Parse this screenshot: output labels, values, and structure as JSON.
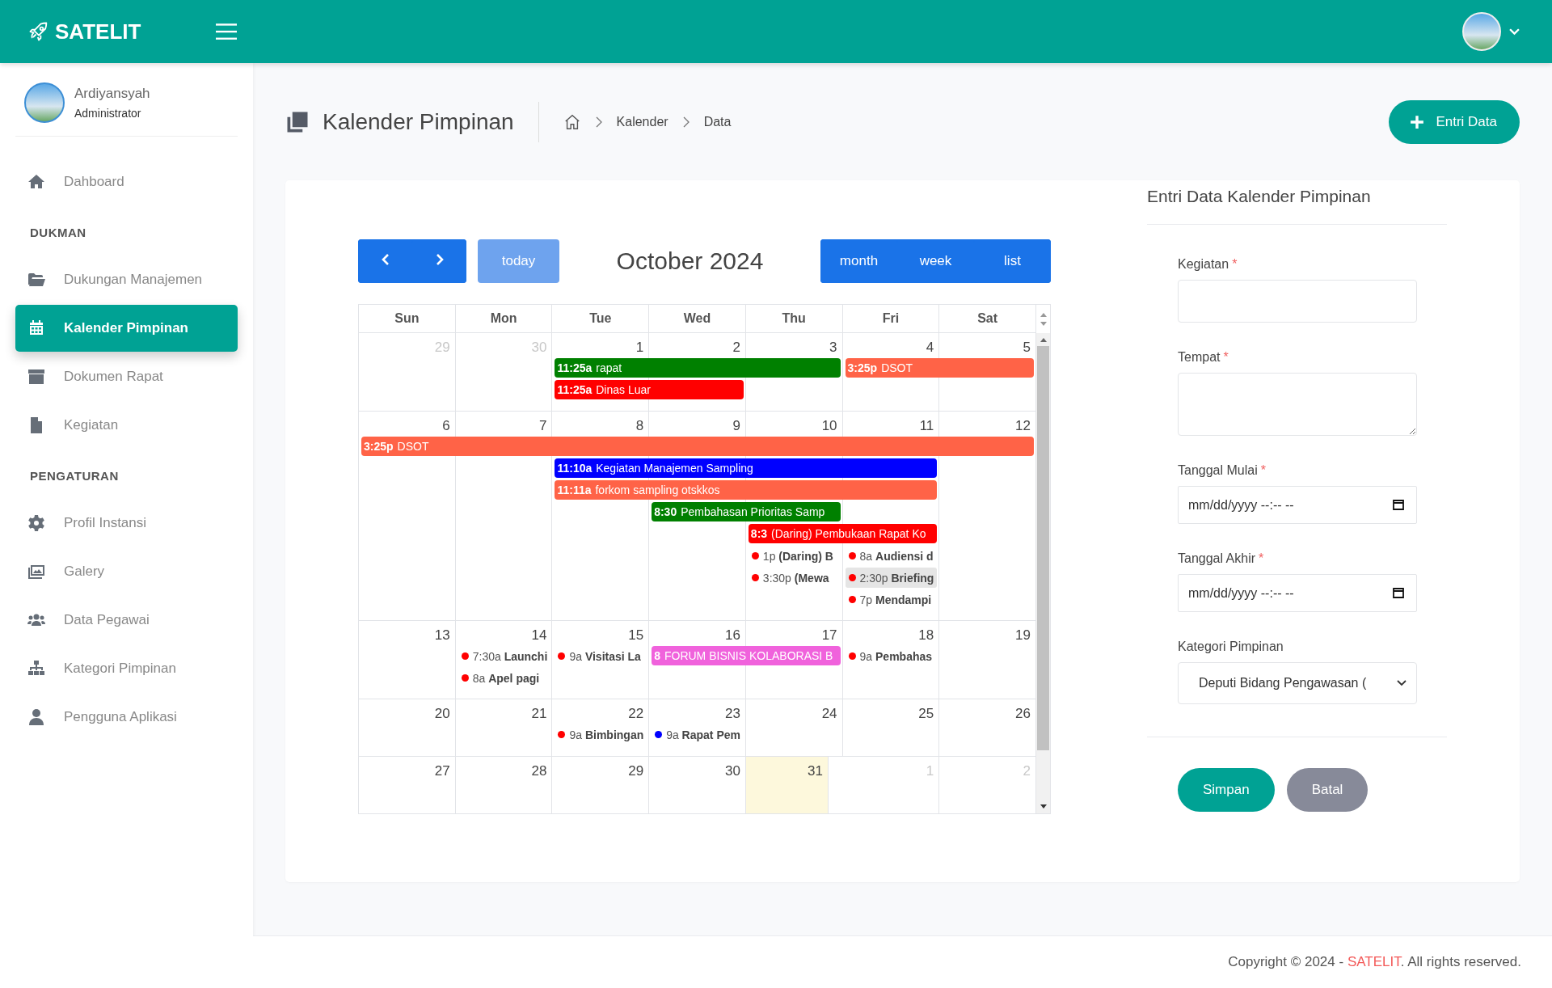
{
  "topbar": {
    "brand": "SATELIT"
  },
  "user": {
    "name": "Ardiyansyah",
    "role": "Administrator"
  },
  "sidebar": {
    "sections": [
      {
        "items": [
          {
            "label": "Dahboard",
            "selected": false
          }
        ]
      },
      {
        "heading": "DUKMAN",
        "items": [
          {
            "label": "Dukungan Manajemen",
            "selected": false
          },
          {
            "label": "Kalender Pimpinan",
            "selected": true
          },
          {
            "label": "Dokumen Rapat",
            "selected": false
          },
          {
            "label": "Kegiatan",
            "selected": false
          }
        ]
      },
      {
        "heading": "PENGATURAN",
        "items": [
          {
            "label": "Profil Instansi",
            "selected": false
          },
          {
            "label": "Galery",
            "selected": false
          },
          {
            "label": "Data Pegawai",
            "selected": false
          },
          {
            "label": "Kategori Pimpinan",
            "selected": false
          },
          {
            "label": "Pengguna Aplikasi",
            "selected": false
          }
        ]
      }
    ]
  },
  "page": {
    "title": "Kalender Pimpinan",
    "breadcrumb": [
      "Kalender",
      "Data"
    ],
    "add_button": "Entri Data"
  },
  "calendar": {
    "today_button": {
      "label": "today",
      "disabled": true
    },
    "title": "October 2024",
    "views": [
      "month",
      "week",
      "list"
    ],
    "weekdays": [
      "Sun",
      "Mon",
      "Tue",
      "Wed",
      "Thu",
      "Fri",
      "Sat"
    ],
    "weeks": [
      {
        "days": [
          {
            "label": "29",
            "other_month": true,
            "today": false
          },
          {
            "label": "30",
            "other_month": true,
            "today": false
          },
          {
            "label": "1",
            "other_month": false,
            "today": false
          },
          {
            "label": "2",
            "other_month": false,
            "today": false
          },
          {
            "label": "3",
            "other_month": false,
            "today": false
          },
          {
            "label": "4",
            "other_month": false,
            "today": false
          },
          {
            "label": "5",
            "other_month": false,
            "today": false
          }
        ],
        "lanes": [
          [
            {
              "kind": "empty"
            },
            {
              "kind": "empty"
            },
            {
              "kind": "bar",
              "time": "11:25a",
              "title": "rapat",
              "color": "#008000"
            },
            {
              "kind": "continued"
            },
            {
              "kind": "continued"
            },
            {
              "kind": "bar",
              "time": "3:25p",
              "title": "DSOT",
              "color": "#ff6347"
            },
            {
              "kind": "continued"
            }
          ],
          [
            {
              "kind": "empty"
            },
            {
              "kind": "empty"
            },
            {
              "kind": "bar",
              "time": "11:25a",
              "title": "Dinas Luar",
              "color": "#ff0000"
            },
            {
              "kind": "continued"
            },
            {
              "kind": "empty"
            },
            {
              "kind": "empty"
            },
            {
              "kind": "empty"
            }
          ]
        ]
      },
      {
        "days": [
          {
            "label": "6",
            "other_month": false,
            "today": false
          },
          {
            "label": "7",
            "other_month": false,
            "today": false
          },
          {
            "label": "8",
            "other_month": false,
            "today": false
          },
          {
            "label": "9",
            "other_month": false,
            "today": false
          },
          {
            "label": "10",
            "other_month": false,
            "today": false
          },
          {
            "label": "11",
            "other_month": false,
            "today": false
          },
          {
            "label": "12",
            "other_month": false,
            "today": false
          }
        ],
        "lanes": [
          [
            {
              "kind": "bar",
              "time": "3:25p",
              "title": "DSOT",
              "color": "#ff6347"
            },
            {
              "kind": "continued"
            },
            {
              "kind": "continued"
            },
            {
              "kind": "continued"
            },
            {
              "kind": "continued"
            },
            {
              "kind": "continued"
            },
            {
              "kind": "continued"
            }
          ],
          [
            {
              "kind": "empty"
            },
            {
              "kind": "empty"
            },
            {
              "kind": "bar",
              "time": "11:10a",
              "title": "Kegiatan Manajemen Sampling",
              "color": "#0000ff"
            },
            {
              "kind": "continued"
            },
            {
              "kind": "continued"
            },
            {
              "kind": "continued"
            },
            {
              "kind": "empty"
            }
          ],
          [
            {
              "kind": "empty"
            },
            {
              "kind": "empty"
            },
            {
              "kind": "bar",
              "time": "11:11a",
              "title": "forkom sampling otskkos",
              "color": "#ff6347"
            },
            {
              "kind": "continued"
            },
            {
              "kind": "continued"
            },
            {
              "kind": "continued"
            },
            {
              "kind": "empty"
            }
          ],
          [
            {
              "kind": "empty"
            },
            {
              "kind": "empty"
            },
            {
              "kind": "empty"
            },
            {
              "kind": "bar",
              "time": "8:30",
              "title": "Pembahasan Prioritas Samp",
              "color": "#008000"
            },
            {
              "kind": "continued"
            },
            {
              "kind": "empty"
            },
            {
              "kind": "empty"
            }
          ],
          [
            {
              "kind": "empty"
            },
            {
              "kind": "empty"
            },
            {
              "kind": "empty"
            },
            {
              "kind": "empty"
            },
            {
              "kind": "bar",
              "time": "8:3",
              "title": "(Daring) Pembukaan Rapat Ko",
              "color": "#ff0000"
            },
            {
              "kind": "continued"
            },
            {
              "kind": "empty"
            }
          ],
          [
            {
              "kind": "empty"
            },
            {
              "kind": "empty"
            },
            {
              "kind": "empty"
            },
            {
              "kind": "empty"
            },
            {
              "kind": "dot",
              "time": "1p",
              "title": "(Daring) B",
              "color": "#ff0000",
              "hovered": false
            },
            {
              "kind": "dot",
              "time": "8a",
              "title": "Audiensi d",
              "color": "#ff0000",
              "hovered": false
            },
            {
              "kind": "empty"
            }
          ],
          [
            {
              "kind": "empty"
            },
            {
              "kind": "empty"
            },
            {
              "kind": "empty"
            },
            {
              "kind": "empty"
            },
            {
              "kind": "dot",
              "time": "3:30p",
              "title": "(Mewa",
              "color": "#ff0000",
              "hovered": false
            },
            {
              "kind": "dot",
              "time": "2:30p",
              "title": "Briefing",
              "color": "#ff0000",
              "hovered": true
            },
            {
              "kind": "empty"
            }
          ],
          [
            {
              "kind": "empty"
            },
            {
              "kind": "empty"
            },
            {
              "kind": "empty"
            },
            {
              "kind": "empty"
            },
            {
              "kind": "empty"
            },
            {
              "kind": "dot",
              "time": "7p",
              "title": "Mendampi",
              "color": "#ff0000",
              "hovered": false
            },
            {
              "kind": "empty"
            }
          ]
        ]
      },
      {
        "days": [
          {
            "label": "13",
            "other_month": false,
            "today": false
          },
          {
            "label": "14",
            "other_month": false,
            "today": false
          },
          {
            "label": "15",
            "other_month": false,
            "today": false
          },
          {
            "label": "16",
            "other_month": false,
            "today": false
          },
          {
            "label": "17",
            "other_month": false,
            "today": false
          },
          {
            "label": "18",
            "other_month": false,
            "today": false
          },
          {
            "label": "19",
            "other_month": false,
            "today": false
          }
        ],
        "lanes": [
          [
            {
              "kind": "empty"
            },
            {
              "kind": "dot",
              "time": "7:30a",
              "title": "Launchi",
              "color": "#ff0000",
              "hovered": false
            },
            {
              "kind": "dot",
              "time": "9a",
              "title": "Visitasi La",
              "color": "#ff0000",
              "hovered": false
            },
            {
              "kind": "bar",
              "time": "8",
              "title": "FORUM BISNIS KOLABORASI B",
              "color": "#f062dc"
            },
            {
              "kind": "continued"
            },
            {
              "kind": "dot",
              "time": "9a",
              "title": "Pembahas",
              "color": "#ff0000",
              "hovered": false
            },
            {
              "kind": "empty"
            }
          ],
          [
            {
              "kind": "empty"
            },
            {
              "kind": "dot",
              "time": "8a",
              "title": "Apel pagi",
              "color": "#ff0000",
              "hovered": false
            },
            {
              "kind": "empty"
            },
            {
              "kind": "empty"
            },
            {
              "kind": "empty"
            },
            {
              "kind": "empty"
            },
            {
              "kind": "empty"
            }
          ]
        ]
      },
      {
        "days": [
          {
            "label": "20",
            "other_month": false,
            "today": false
          },
          {
            "label": "21",
            "other_month": false,
            "today": false
          },
          {
            "label": "22",
            "other_month": false,
            "today": false
          },
          {
            "label": "23",
            "other_month": false,
            "today": false
          },
          {
            "label": "24",
            "other_month": false,
            "today": false
          },
          {
            "label": "25",
            "other_month": false,
            "today": false
          },
          {
            "label": "26",
            "other_month": false,
            "today": false
          }
        ],
        "lanes": [
          [
            {
              "kind": "empty"
            },
            {
              "kind": "empty"
            },
            {
              "kind": "dot",
              "time": "9a",
              "title": "Bimbingan",
              "color": "#ff0000",
              "hovered": false
            },
            {
              "kind": "dot",
              "time": "9a",
              "title": "Rapat Pem",
              "color": "#0000ff",
              "hovered": false
            },
            {
              "kind": "empty"
            },
            {
              "kind": "empty"
            },
            {
              "kind": "empty"
            }
          ]
        ]
      },
      {
        "days": [
          {
            "label": "27",
            "other_month": false,
            "today": false
          },
          {
            "label": "28",
            "other_month": false,
            "today": false
          },
          {
            "label": "29",
            "other_month": false,
            "today": false
          },
          {
            "label": "30",
            "other_month": false,
            "today": false
          },
          {
            "label": "31",
            "other_month": false,
            "today": true
          },
          {
            "label": "1",
            "other_month": true,
            "today": false
          },
          {
            "label": "2",
            "other_month": true,
            "today": false
          }
        ]
      }
    ]
  },
  "form": {
    "title": "Entri Data Kalender Pimpinan",
    "required_mark": "*",
    "fields": [
      {
        "label": "Kegiatan",
        "required": true,
        "kind": "text"
      },
      {
        "label": "Tempat",
        "required": true,
        "kind": "textarea"
      },
      {
        "label": "Tanggal Mulai",
        "required": true,
        "kind": "datetime",
        "placeholder": "mm/dd/yyyy --:-- --"
      },
      {
        "label": "Tanggal Akhir",
        "required": true,
        "kind": "datetime",
        "placeholder": "mm/dd/yyyy --:-- --"
      },
      {
        "label": "Kategori Pimpinan",
        "required": false,
        "kind": "select",
        "value": "Deputi Bidang Pengawasan ("
      }
    ],
    "buttons": [
      {
        "label": "Simpan",
        "kind": "primary"
      },
      {
        "label": "Batal",
        "kind": "secondary"
      }
    ]
  },
  "footer": {
    "prefix": "Copyright © 2024 - ",
    "link": "SATELIT",
    "suffix": ". All rights reserved."
  }
}
